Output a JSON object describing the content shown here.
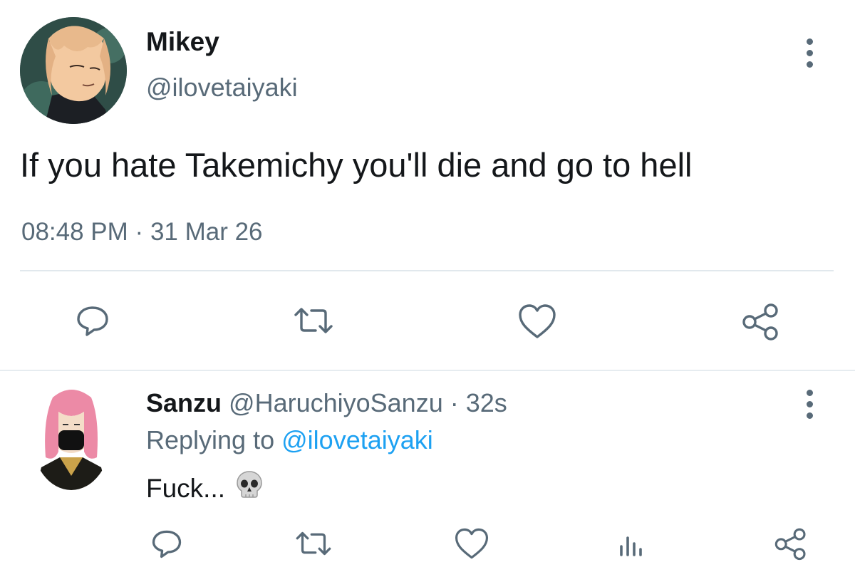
{
  "main_tweet": {
    "author_name": "Mikey",
    "handle": "@ilovetaiyaki",
    "text": "If you hate Takemichy you'll die and go to hell",
    "time": "08:48 PM",
    "separator": "·",
    "date": "31 Mar 26",
    "actions": [
      "reply",
      "retweet",
      "like",
      "share"
    ]
  },
  "reply_tweet": {
    "author_name": "Sanzu",
    "handle": "@HaruchiyoSanzu",
    "separator": "·",
    "time_ago": "32s",
    "replying_prefix": "Replying to",
    "replying_to": "@ilovetaiyaki",
    "text": "Fuck...",
    "emoji": "skull-emoji",
    "actions": [
      "reply",
      "retweet",
      "like",
      "analytics",
      "share"
    ]
  },
  "colors": {
    "text_primary": "#14171a",
    "text_secondary": "#586a78",
    "link": "#1da1f2",
    "divider": "#e1e8ed",
    "background": "#ffffff"
  },
  "icons": {
    "more": "more-vertical-icon",
    "reply": "reply-bubble-icon",
    "retweet": "retweet-icon",
    "like": "heart-icon",
    "share": "share-icon",
    "analytics": "analytics-icon"
  }
}
